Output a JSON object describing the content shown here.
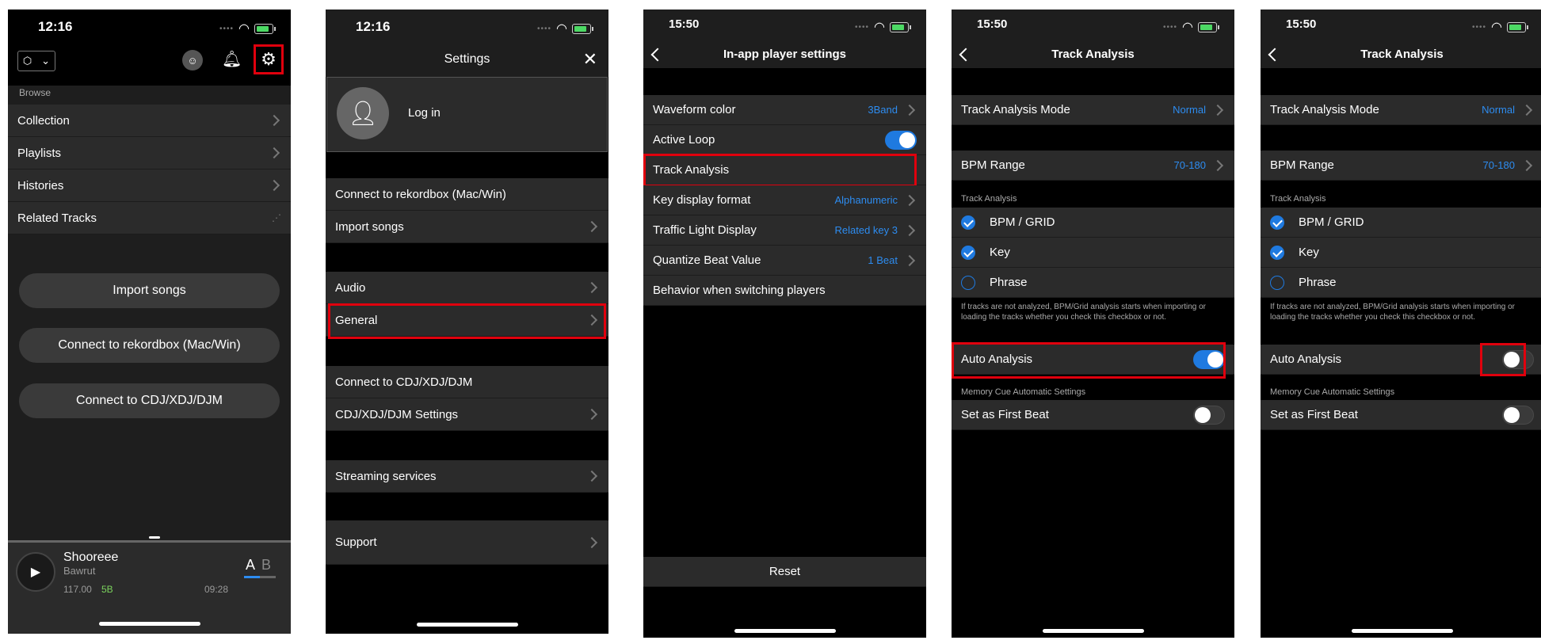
{
  "screen1": {
    "time": "12:16",
    "section_browse": "Browse",
    "browse_items": [
      "Collection",
      "Playlists",
      "Histories",
      "Related Tracks"
    ],
    "buttons": [
      "Import songs",
      "Connect to rekordbox (Mac/Win)",
      "Connect to CDJ/XDJ/DJM"
    ],
    "player": {
      "title": "Shooreee",
      "artist": "Bawrut",
      "bpm": "117.00",
      "key": "5B",
      "duration": "09:28",
      "deck_a": "A",
      "deck_b": "B"
    }
  },
  "screen2": {
    "time": "12:16",
    "title": "Settings",
    "login": "Log in",
    "items": {
      "connect_rekordbox": "Connect to rekordbox (Mac/Win)",
      "import_songs": "Import songs",
      "audio": "Audio",
      "general": "General",
      "connect_cdj": "Connect to CDJ/XDJ/DJM",
      "cdj_settings": "CDJ/XDJ/DJM Settings",
      "streaming": "Streaming services",
      "support": "Support"
    }
  },
  "screen3": {
    "time": "15:50",
    "title": "In-app player settings",
    "rows": [
      {
        "label": "Waveform color",
        "value": "3Band"
      },
      {
        "label": "Active Loop",
        "value": ""
      },
      {
        "label": "Track Analysis",
        "value": ""
      },
      {
        "label": "Key display format",
        "value": "Alphanumeric"
      },
      {
        "label": "Traffic Light Display",
        "value": "Related key 3"
      },
      {
        "label": "Quantize Beat Value",
        "value": "1 Beat"
      },
      {
        "label": "Behavior when switching players",
        "value": ""
      }
    ],
    "active_loop_on": true,
    "reset": "Reset"
  },
  "screen4": {
    "time": "15:50",
    "title": "Track Analysis",
    "mode_label": "Track Analysis Mode",
    "mode_value": "Normal",
    "bpm_label": "BPM Range",
    "bpm_value": "70-180",
    "section": "Track Analysis",
    "checks": [
      "BPM / GRID",
      "Key",
      "Phrase"
    ],
    "checks_state": [
      true,
      true,
      false
    ],
    "note": "If tracks are not analyzed, BPM/Grid analysis starts when importing or loading the tracks whether you check this checkbox or not.",
    "auto_label": "Auto Analysis",
    "auto_on": true,
    "memory_section": "Memory Cue Automatic Settings",
    "first_beat": "Set as First Beat",
    "first_beat_on": false
  },
  "screen5": {
    "time": "15:50",
    "title": "Track Analysis",
    "mode_label": "Track Analysis Mode",
    "mode_value": "Normal",
    "bpm_label": "BPM Range",
    "bpm_value": "70-180",
    "section": "Track Analysis",
    "checks": [
      "BPM / GRID",
      "Key",
      "Phrase"
    ],
    "checks_state": [
      true,
      true,
      false
    ],
    "note": "If tracks are not analyzed, BPM/Grid analysis starts when importing or loading the tracks whether you check this checkbox or not.",
    "auto_label": "Auto Analysis",
    "auto_on": false,
    "memory_section": "Memory Cue Automatic Settings",
    "first_beat": "Set as First Beat",
    "first_beat_on": false
  },
  "colors": {
    "highlight": "#e0000d",
    "accent": "#2d8cf0",
    "key_green": "#4cd964"
  }
}
